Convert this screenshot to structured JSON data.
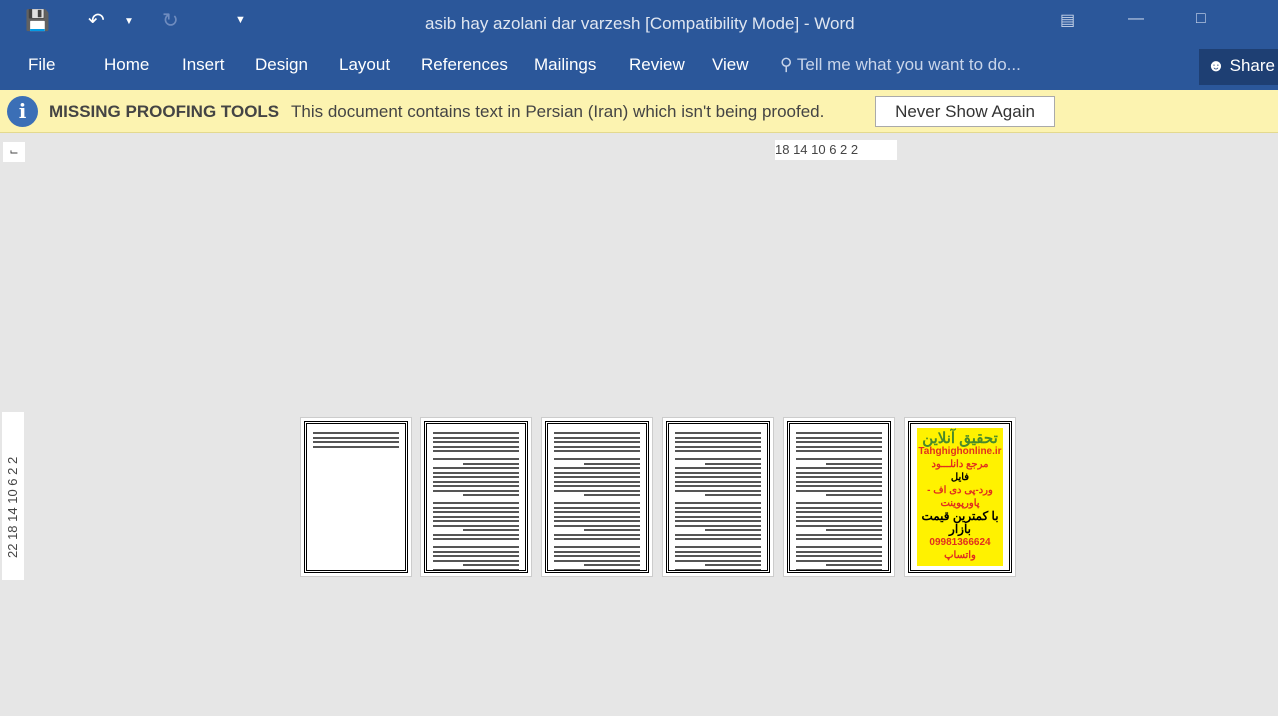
{
  "window": {
    "title": "asib hay azolani dar varzesh [Compatibility Mode] - Word"
  },
  "quick_access": {
    "save_icon": "save-icon",
    "undo_icon": "undo-icon",
    "redo_icon": "redo-icon",
    "customize_icon": "customize-icon"
  },
  "ribbon": {
    "tabs": [
      "File",
      "Home",
      "Insert",
      "Design",
      "Layout",
      "References",
      "Mailings",
      "Review",
      "View"
    ],
    "tell_me": "Tell me what you want to do...",
    "share": "Share"
  },
  "message_bar": {
    "title": "MISSING PROOFING TOOLS",
    "message": "This document contains text in Persian (Iran) which isn't being proofed.",
    "button": "Never Show Again"
  },
  "ruler": {
    "horizontal": "18 14 10 6 2 2",
    "vertical": "22 18 14 10 6 2 2"
  },
  "ad": {
    "lines": [
      "تحقیق آنلاین",
      "Tahghighonline.ir",
      "مرجع دانلـــود",
      "فایل",
      "ورد-پی دی اف - پاورپوینت",
      "با کمترین قیمت بازار",
      "09981366624 واتساپ"
    ]
  },
  "colors": {
    "ribbon": "#2b579a",
    "message_bar": "#fcf3b0",
    "ad_bg": "#fff200"
  }
}
